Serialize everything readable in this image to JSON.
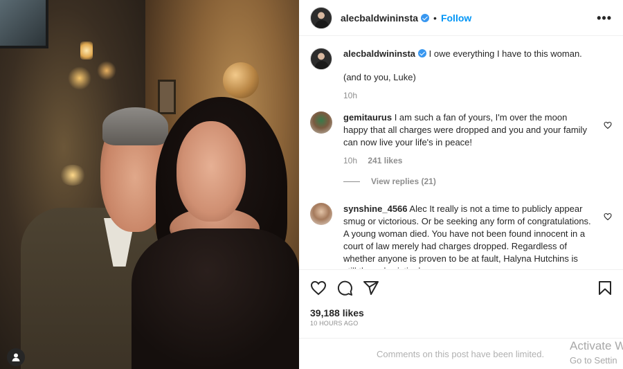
{
  "post": {
    "username": "alecbaldwininsta",
    "dot": "•",
    "follow_label": "Follow",
    "more_label": "•••",
    "caption": "I owe everything I have to this woman.",
    "caption_line2": "(and to you, Luke)",
    "caption_time": "10h"
  },
  "comments": [
    {
      "username": "gemitaurus",
      "text": "I am such a fan of yours, I'm over the moon happy that all charges were dropped and you and your family can now live your life's in peace!",
      "time": "10h",
      "likes": "241 likes",
      "view_replies": "View replies (21)"
    },
    {
      "username": "synshine_4566",
      "text": "Alec It really is not a time to publicly appear smug or victorious. Or be seeking any form of congratulations. A young woman died. You have not been found innocent in a court of law merely had charges dropped. Regardless of whether anyone is proven to be at fault, Halyna Hutchins is still the only victim here."
    }
  ],
  "stats": {
    "likes": "39,188 likes",
    "time_ago": "10 HOURS AGO"
  },
  "footer": {
    "limited": "Comments on this post have been limited."
  },
  "watermark": {
    "line1": "Activate W",
    "line2": "Go to Settin"
  },
  "icons": {
    "verified": "verified-badge-icon",
    "like": "heart-icon",
    "comment": "comment-icon",
    "share": "send-icon",
    "save": "bookmark-icon",
    "user_tag": "user-tag-icon"
  },
  "colors": {
    "accent": "#0095f6",
    "verified": "#3897f0",
    "muted": "#8e8e8e"
  }
}
